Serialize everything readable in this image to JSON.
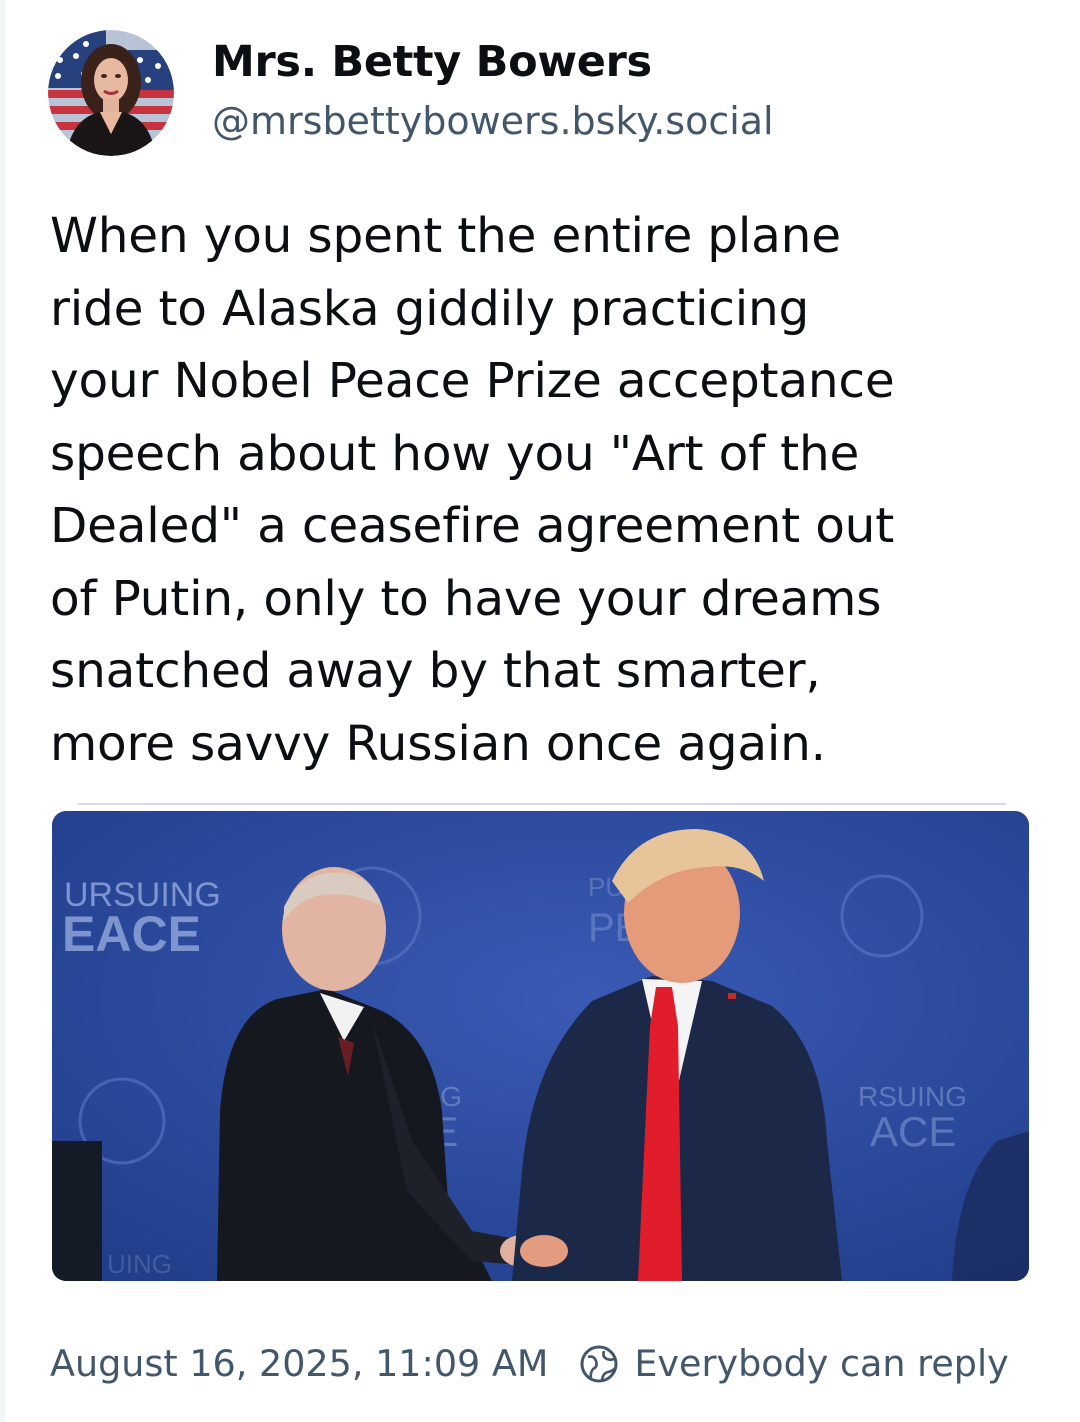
{
  "post": {
    "author": {
      "display_name": "Mrs. Betty Bowers",
      "handle": "@mrsbettybowers.bsky.social",
      "avatar_icon": "avatar-woman-flag"
    },
    "text": "When you spent the entire plane\nride to Alaska giddily practicing\nyour Nobel Peace Prize acceptance\nspeech about how you \"Art of the\nDealed\" a ceasefire agreement out\nof Putin, only to have your dreams\nsnatched away by that smarter,\nmore savvy Russian once again.",
    "image": {
      "backdrop_texts": [
        "URSUING",
        "EACE",
        "PU",
        "PE",
        "UING",
        "CE",
        "RSUING",
        "ACE",
        "UING"
      ]
    },
    "timestamp": "August 16, 2025, 11:09 AM",
    "reply_setting": {
      "icon": "globe-icon",
      "label": "Everybody can reply"
    },
    "colors": {
      "text_primary": "#0b0f14",
      "text_secondary": "#42576c",
      "backdrop_blue": "#2f4fa6"
    }
  }
}
